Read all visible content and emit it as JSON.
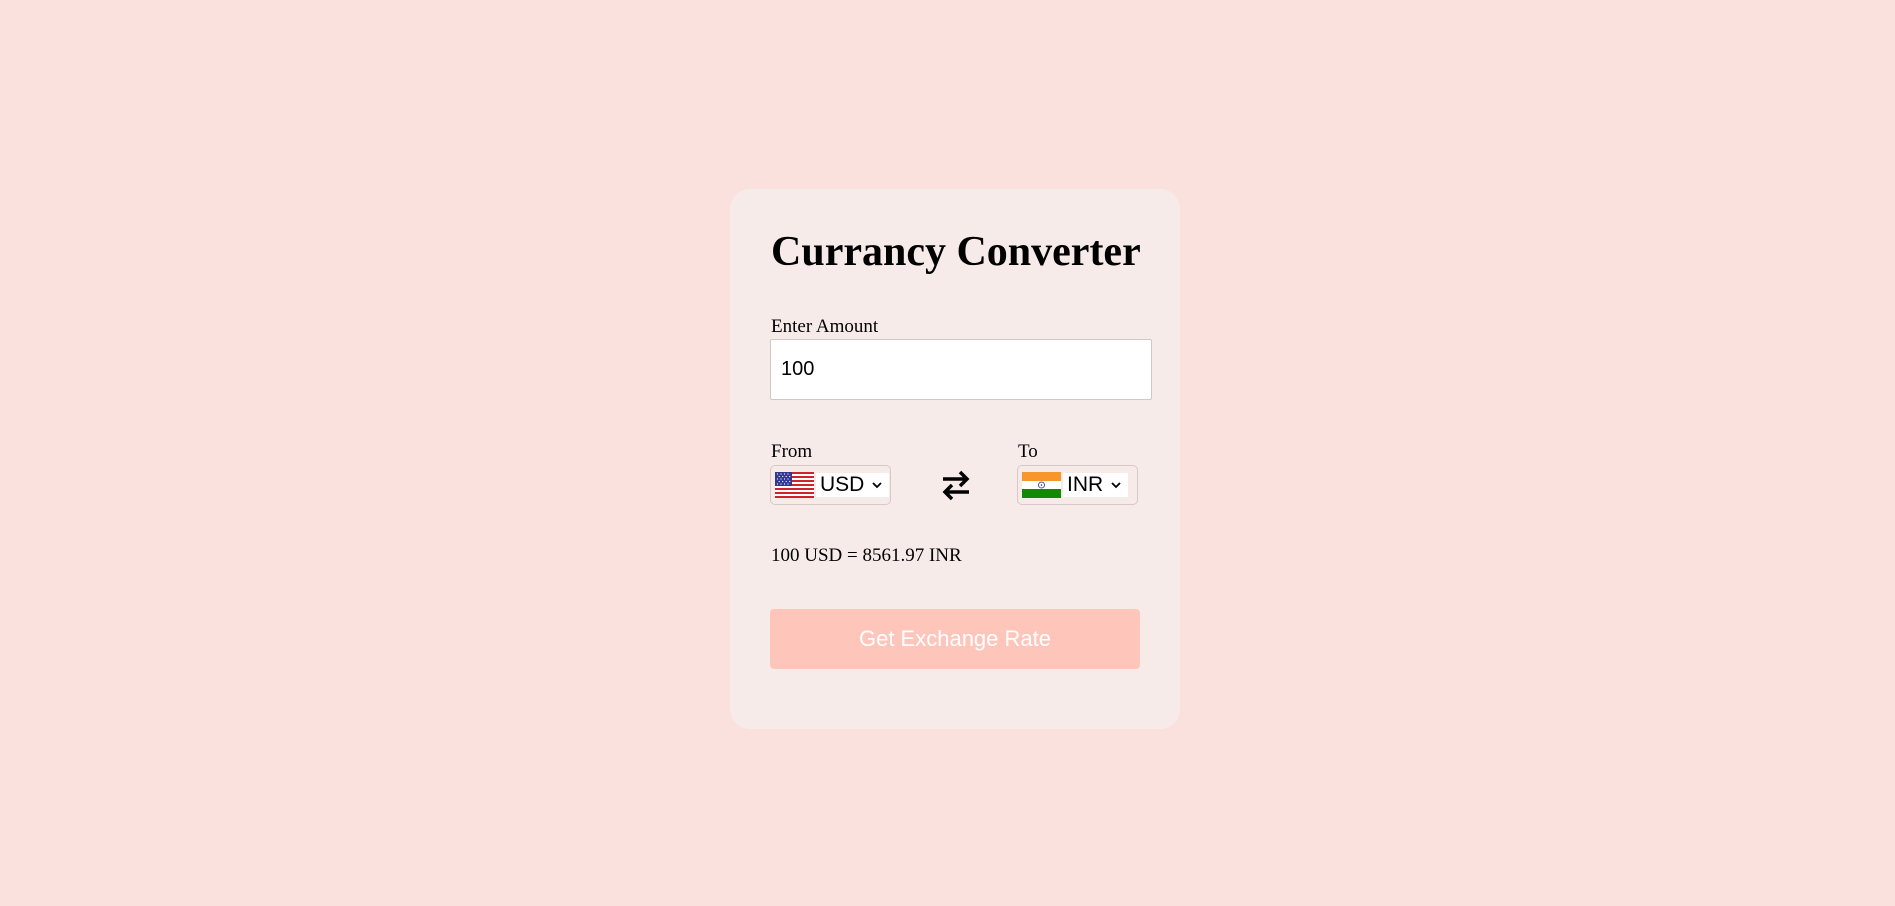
{
  "converter": {
    "title": "Currancy Converter",
    "amount_label": "Enter Amount",
    "amount_value": "100",
    "from_label": "From",
    "to_label": "To",
    "from_currency": "USD",
    "to_currency": "INR",
    "from_flag_icon": "us-flag-icon",
    "to_flag_icon": "india-flag-icon",
    "swap_icon": "swap-arrows-icon",
    "result_text": "100 USD = 8561.97 INR",
    "button_label": "Get Exchange Rate"
  },
  "colors": {
    "page_background": "#fbe1dd",
    "card_background": "#f7ebe9",
    "button_background": "#fec6bb",
    "button_text": "#ffffff"
  }
}
